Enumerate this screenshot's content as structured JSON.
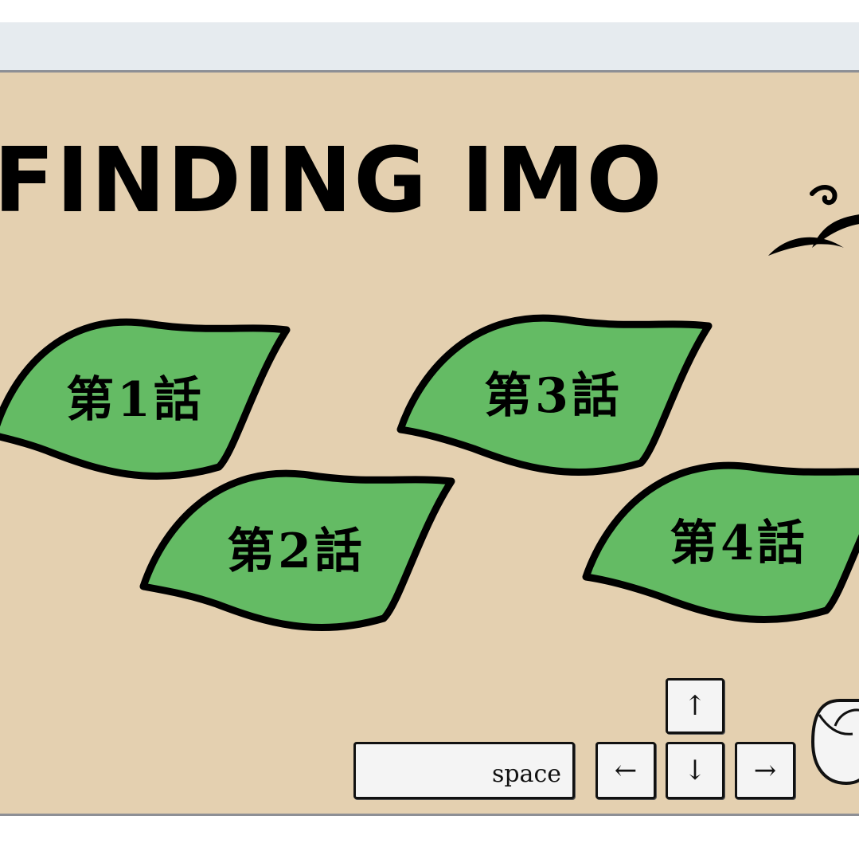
{
  "game": {
    "title": "FINDING IMO",
    "episodes": [
      {
        "label": "第1話"
      },
      {
        "label": "第2話"
      },
      {
        "label": "第3話"
      },
      {
        "label": "第4話"
      }
    ],
    "controls": {
      "space": "space",
      "up": "↑",
      "down": "↓",
      "left": "←",
      "right": "→"
    }
  },
  "colors": {
    "background": "#e4d0b0",
    "leaf": "#64bb64",
    "outline": "#000000",
    "browser_strip": "#e6ebef"
  },
  "icons": [
    "mouse-icon",
    "leaf-icon",
    "swirl-ornament"
  ]
}
